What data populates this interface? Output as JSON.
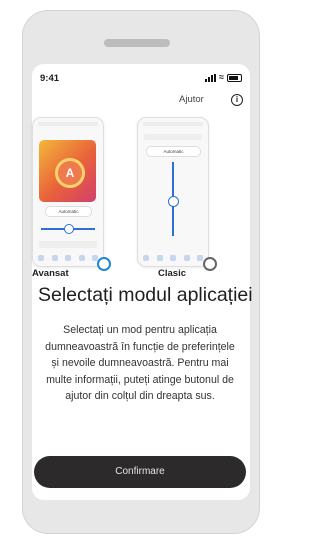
{
  "status_bar": {
    "time": "9:41"
  },
  "header": {
    "help_label": "Ajutor",
    "info_icon": "info-icon"
  },
  "modes": [
    {
      "label": "Avansat",
      "selected": true,
      "preview_text": "Automatic",
      "preview_letter": "A"
    },
    {
      "label": "Clasic",
      "selected": false,
      "preview_text": "Automatic"
    }
  ],
  "title": "Selectați modul aplicației",
  "description": "Selectați un mod pentru aplicația dumneavoastră în funcție de preferințele și nevoile dumneavoastră. Pentru mai multe informații, puteți atinge butonul de ajutor din colțul din dreapta sus.",
  "confirm_label": "Confirmare",
  "colors": {
    "accent": "#1f88c9",
    "button": "#2c2a2a"
  }
}
